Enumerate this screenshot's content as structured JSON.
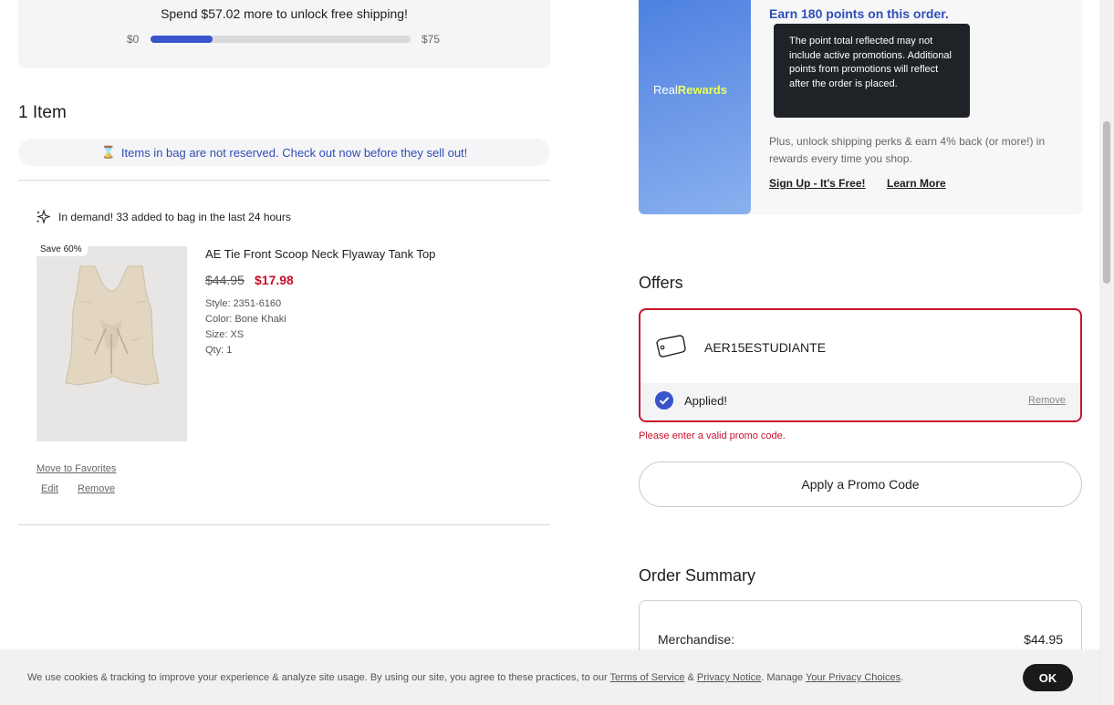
{
  "shipping": {
    "message": "Spend $57.02 more to unlock free shipping!",
    "min_label": "$0",
    "max_label": "$75",
    "progress_fraction": 0.24
  },
  "bag": {
    "title": "1 Item",
    "reserve_notice": "Items in bag are not reserved. Check out now before they sell out!"
  },
  "item": {
    "demand_text": "In demand! 33 added to bag in the last 24 hours",
    "badge": "Save 60%",
    "name": "AE Tie Front Scoop Neck Flyaway Tank Top",
    "price_original": "$44.95",
    "price_sale": "$17.98",
    "style": "Style: 2351-6160",
    "color": "Color: Bone Khaki",
    "size": "Size: XS",
    "qty": "Qty: 1",
    "move_to_favorites": "Move to Favorites",
    "edit": "Edit",
    "remove": "Remove"
  },
  "rewards": {
    "logo_prefix": "Real",
    "logo_suffix": "Rewards",
    "earn_text": "Earn 180 points on this order.",
    "tooltip": "The point total reflected may not include active promotions. Additional points from promotions will reflect after the order is placed.",
    "description": "Plus, unlock shipping perks & earn 4% back (or more!) in rewards every time you shop.",
    "signup_link": "Sign Up - It's Free!",
    "learn_more_link": "Learn More"
  },
  "offers": {
    "title": "Offers",
    "code": "AER15ESTUDIANTE",
    "status": "Applied!",
    "remove": "Remove",
    "error": "Please enter a valid promo code.",
    "apply_button": "Apply a Promo Code"
  },
  "summary": {
    "title": "Order Summary",
    "merchandise_label": "Merchandise:",
    "merchandise_value": "$44.95"
  },
  "cookie": {
    "text_1": "We use cookies & tracking to improve your experience & analyze site usage. By using our site, you agree to these practices, to our ",
    "terms": "Terms of Service",
    "amp": " & ",
    "privacy": "Privacy Notice",
    "text_2": ". Manage ",
    "your_privacy": "Your Privacy Choices",
    "text_3": ".",
    "ok": "OK"
  },
  "colors": {
    "accent_blue": "#3a55cc",
    "sale_red": "#c8102e",
    "rewards_yellow": "#e7ff5a"
  }
}
